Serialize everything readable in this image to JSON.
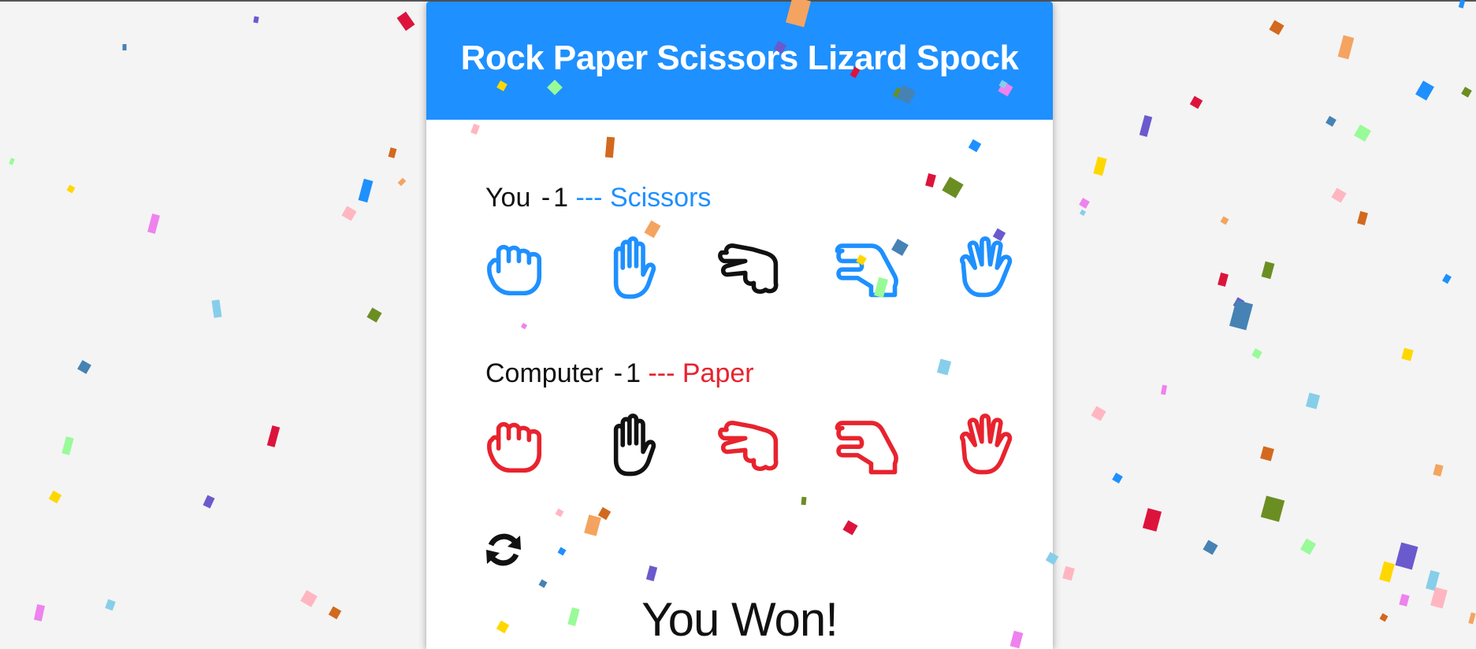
{
  "title": "Rock Paper Scissors Lizard Spock",
  "player": {
    "name": "You",
    "separator": "-",
    "score": "1",
    "choice_prefix": "---",
    "choice": "Scissors",
    "color": "#1e90ff",
    "selected_color": "#111111",
    "selected_index": 2
  },
  "computer": {
    "name": "Computer",
    "separator": "-",
    "score": "1",
    "choice_prefix": "---",
    "choice": "Paper",
    "color": "#e8232e",
    "selected_color": "#111111",
    "selected_index": 1
  },
  "hands": [
    {
      "name": "Rock",
      "icon": "hand-rock-icon"
    },
    {
      "name": "Paper",
      "icon": "hand-paper-icon"
    },
    {
      "name": "Scissors",
      "icon": "hand-scissors-icon"
    },
    {
      "name": "Lizard",
      "icon": "hand-lizard-icon"
    },
    {
      "name": "Spock",
      "icon": "hand-spock-icon"
    }
  ],
  "reset_icon": "sync-icon",
  "result": "You Won!",
  "colors": {
    "header": "#1e90ff",
    "background": "#f4f4f4",
    "confetti": [
      "#dc143c",
      "#6a5acd",
      "#4682b4",
      "#98fb98",
      "#ffd700",
      "#ee82ee",
      "#87ceeb",
      "#ffb6c1",
      "#d2691e",
      "#f4a460",
      "#1e90ff",
      "#6b8e23"
    ]
  }
}
